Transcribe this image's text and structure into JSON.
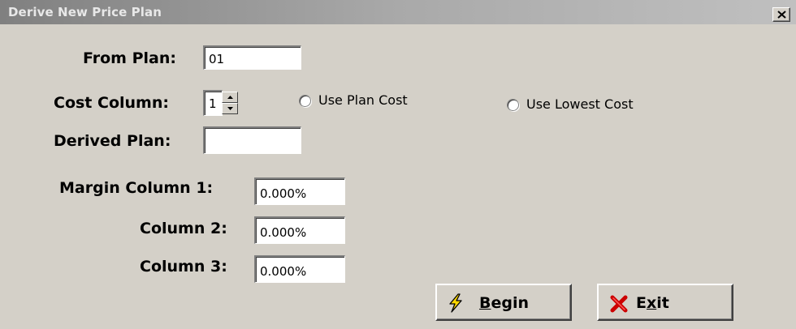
{
  "window": {
    "title": "Derive New Price Plan"
  },
  "form": {
    "from_plan": {
      "label": "From Plan:",
      "value": "01"
    },
    "cost_column": {
      "label": "Cost Column:",
      "value": "1"
    },
    "derived_plan": {
      "label": "Derived Plan:",
      "value": ""
    },
    "margin_column_1": {
      "label": "Margin Column 1:",
      "value": "0.000%"
    },
    "column_2": {
      "label": "Column 2:",
      "value": "0.000%"
    },
    "column_3": {
      "label": "Column 3:",
      "value": "0.000%"
    }
  },
  "cost_options": {
    "use_plan_cost": {
      "label": "Use Plan Cost",
      "selected": false
    },
    "use_lowest_cost": {
      "label": "Use Lowest Cost",
      "selected": false
    }
  },
  "buttons": {
    "begin": {
      "pre": "",
      "accel": "B",
      "post": "egin",
      "icon": "lightning-icon"
    },
    "exit": {
      "pre": "E",
      "accel": "x",
      "post": "it",
      "icon": "red-x-icon"
    }
  },
  "colors": {
    "face": "#d4d0c8",
    "title_gradient_start": "#808080",
    "title_gradient_end": "#c0c0c0",
    "exit_icon": "#cc0000",
    "begin_icon": "#ffd800"
  }
}
